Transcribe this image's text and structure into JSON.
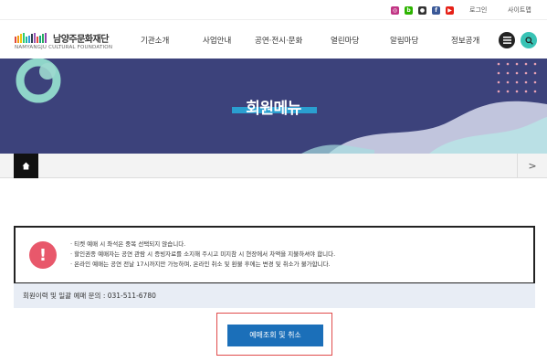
{
  "util": {
    "sns": [
      {
        "name": "instagram-icon",
        "glyph": "◎",
        "color": "#c13584"
      },
      {
        "name": "blog-icon",
        "glyph": "b",
        "color": "#2db400"
      },
      {
        "name": "talk-icon",
        "glyph": "●",
        "color": "#333333"
      },
      {
        "name": "facebook-icon",
        "glyph": "f",
        "color": "#3b5998"
      },
      {
        "name": "youtube-icon",
        "glyph": "▶",
        "color": "#e62117"
      }
    ],
    "login": "로그인",
    "sitemap": "사이트맵"
  },
  "header": {
    "logo_name": "남양주문화재단",
    "logo_sub": "NAMYANGJU CULTURAL FOUNDATION",
    "logo_colors": [
      "#e24a3b",
      "#f39c12",
      "#f1c40f",
      "#2ecc71",
      "#1abc9c",
      "#3498db",
      "#2c3e50",
      "#9b59b6",
      "#e74c3c",
      "#16a085",
      "#27ae60",
      "#8e44ad"
    ],
    "nav": [
      "기관소개",
      "사업안내",
      "공연·전시·문화",
      "열린마당",
      "알림마당",
      "정보공개"
    ],
    "menu_color": "#222222",
    "search_color": "#38c3b5"
  },
  "banner": {
    "title": "회원메뉴",
    "bg_color": "#3c427b",
    "accent_color": "#2a9fd0"
  },
  "breadcrumb": {
    "next": ">"
  },
  "notice": {
    "icon": "!",
    "items": [
      "티켓 예매 시 좌석은 중복 선택되지 않습니다.",
      "할인권종 예매자는 공연 관람 시 증빙자료를 소지해 주시고 미지참 시 현장에서 차액을 지불하셔야 합니다.",
      "온라인 예매는 공연 전날 17시까지만 가능하며, 온라인 취소 및 환불 후에는 변경 및 취소가 불가합니다."
    ],
    "contact": "회원이력 및 일괄 예매 문의 : 031-511-6780"
  },
  "action": {
    "button": "예매조회 및 취소"
  }
}
